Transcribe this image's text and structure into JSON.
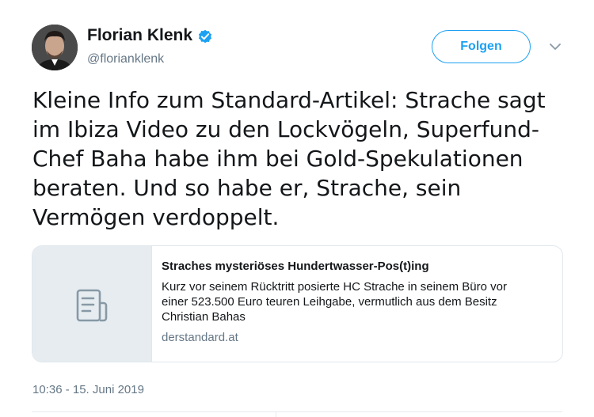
{
  "tweet": {
    "author": {
      "display_name": "Florian Klenk",
      "handle": "@florianklenk",
      "verified_icon": "verified-badge-icon"
    },
    "follow_label": "Folgen",
    "menu_icon": "chevron-down-icon",
    "text_lines": [
      "Kleine Info zum Standard-Artikel: Strache sagt",
      "im Ibiza Video zu den Lockvögeln, Superfund-",
      "Chef Baha habe ihm bei Gold-Spekulationen",
      "beraten. Und so habe er, Strache, sein",
      "Vermögen verdoppelt."
    ],
    "card": {
      "thumb_icon": "document-icon",
      "title": "Straches mysteriöses Hundertwasser-Pos(t)ing",
      "description_lines": [
        "Kurz vor seinem Rücktritt posierte HC Strache in seinem Büro vor",
        "einer 523.500 Euro teuren Leihgabe, vermutlich aus dem Besitz",
        "Christian Bahas"
      ],
      "domain": "derstandard.at"
    },
    "timestamp": "10:36 - 15. Juni 2019"
  },
  "colors": {
    "accent": "#1da1f2",
    "text_primary": "#14171a",
    "text_secondary": "#657786",
    "card_thumb_bg": "#e6ecf0",
    "border": "#e1e8ed"
  }
}
